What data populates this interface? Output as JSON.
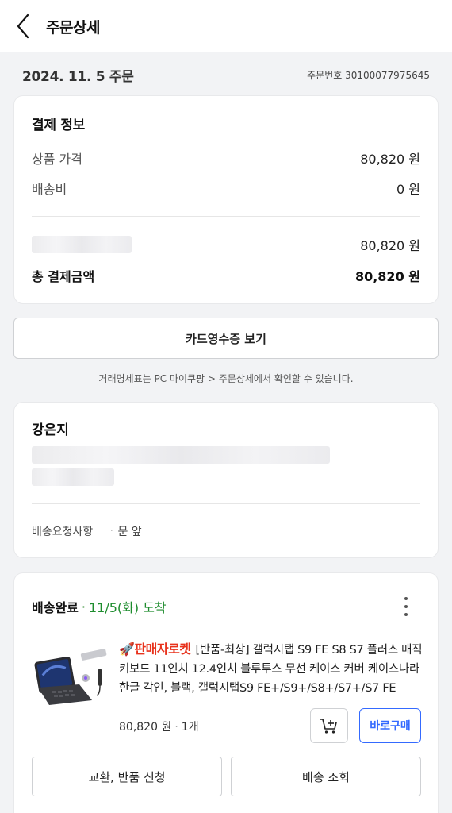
{
  "header": {
    "title": "주문상세",
    "back_icon": "chevron-left-icon"
  },
  "order": {
    "date": "2024. 11. 5 주문",
    "number": "주문번호 30100077975645"
  },
  "payment": {
    "title": "결제 정보",
    "product_price_label": "상품 가격",
    "product_price_value": "80,820 원",
    "shipping_label": "배송비",
    "shipping_value": "0 원",
    "method_value": "80,820 원",
    "total_label": "총 결제금액",
    "total_value": "80,820 원"
  },
  "receipt_button": "카드영수증 보기",
  "notice": "거래명세표는 PC 마이쿠팡 > 주문상세에서 확인할 수 있습니다.",
  "address": {
    "recipient": "강은지",
    "request_label": "배송요청사항",
    "request_value": "문 앞"
  },
  "shipment": {
    "status": "배송완료",
    "separator": "·",
    "arrival": "11/5(화) 도착",
    "rocket_label": "🚀판매자로켓",
    "product_name": "[반품-최상] 갤럭시탭 S9 FE S8 S7 플러스 매직 키보드 11인치 12.4인치 블루투스 무선 케이스 커버 케이스나라 한글 각인, 블랙, 갤럭시탭S9 FE+/S9+/S8+/S7+/S7 FE",
    "price": "80,820 원",
    "qty": "1개",
    "buy_now": "바로구매",
    "exchange_return": "교환, 반품 신청",
    "track": "배송 조회"
  },
  "colors": {
    "accent_blue": "#346aff",
    "arrival_green": "#1d8c2d",
    "rocket_red": "#e8321c"
  }
}
